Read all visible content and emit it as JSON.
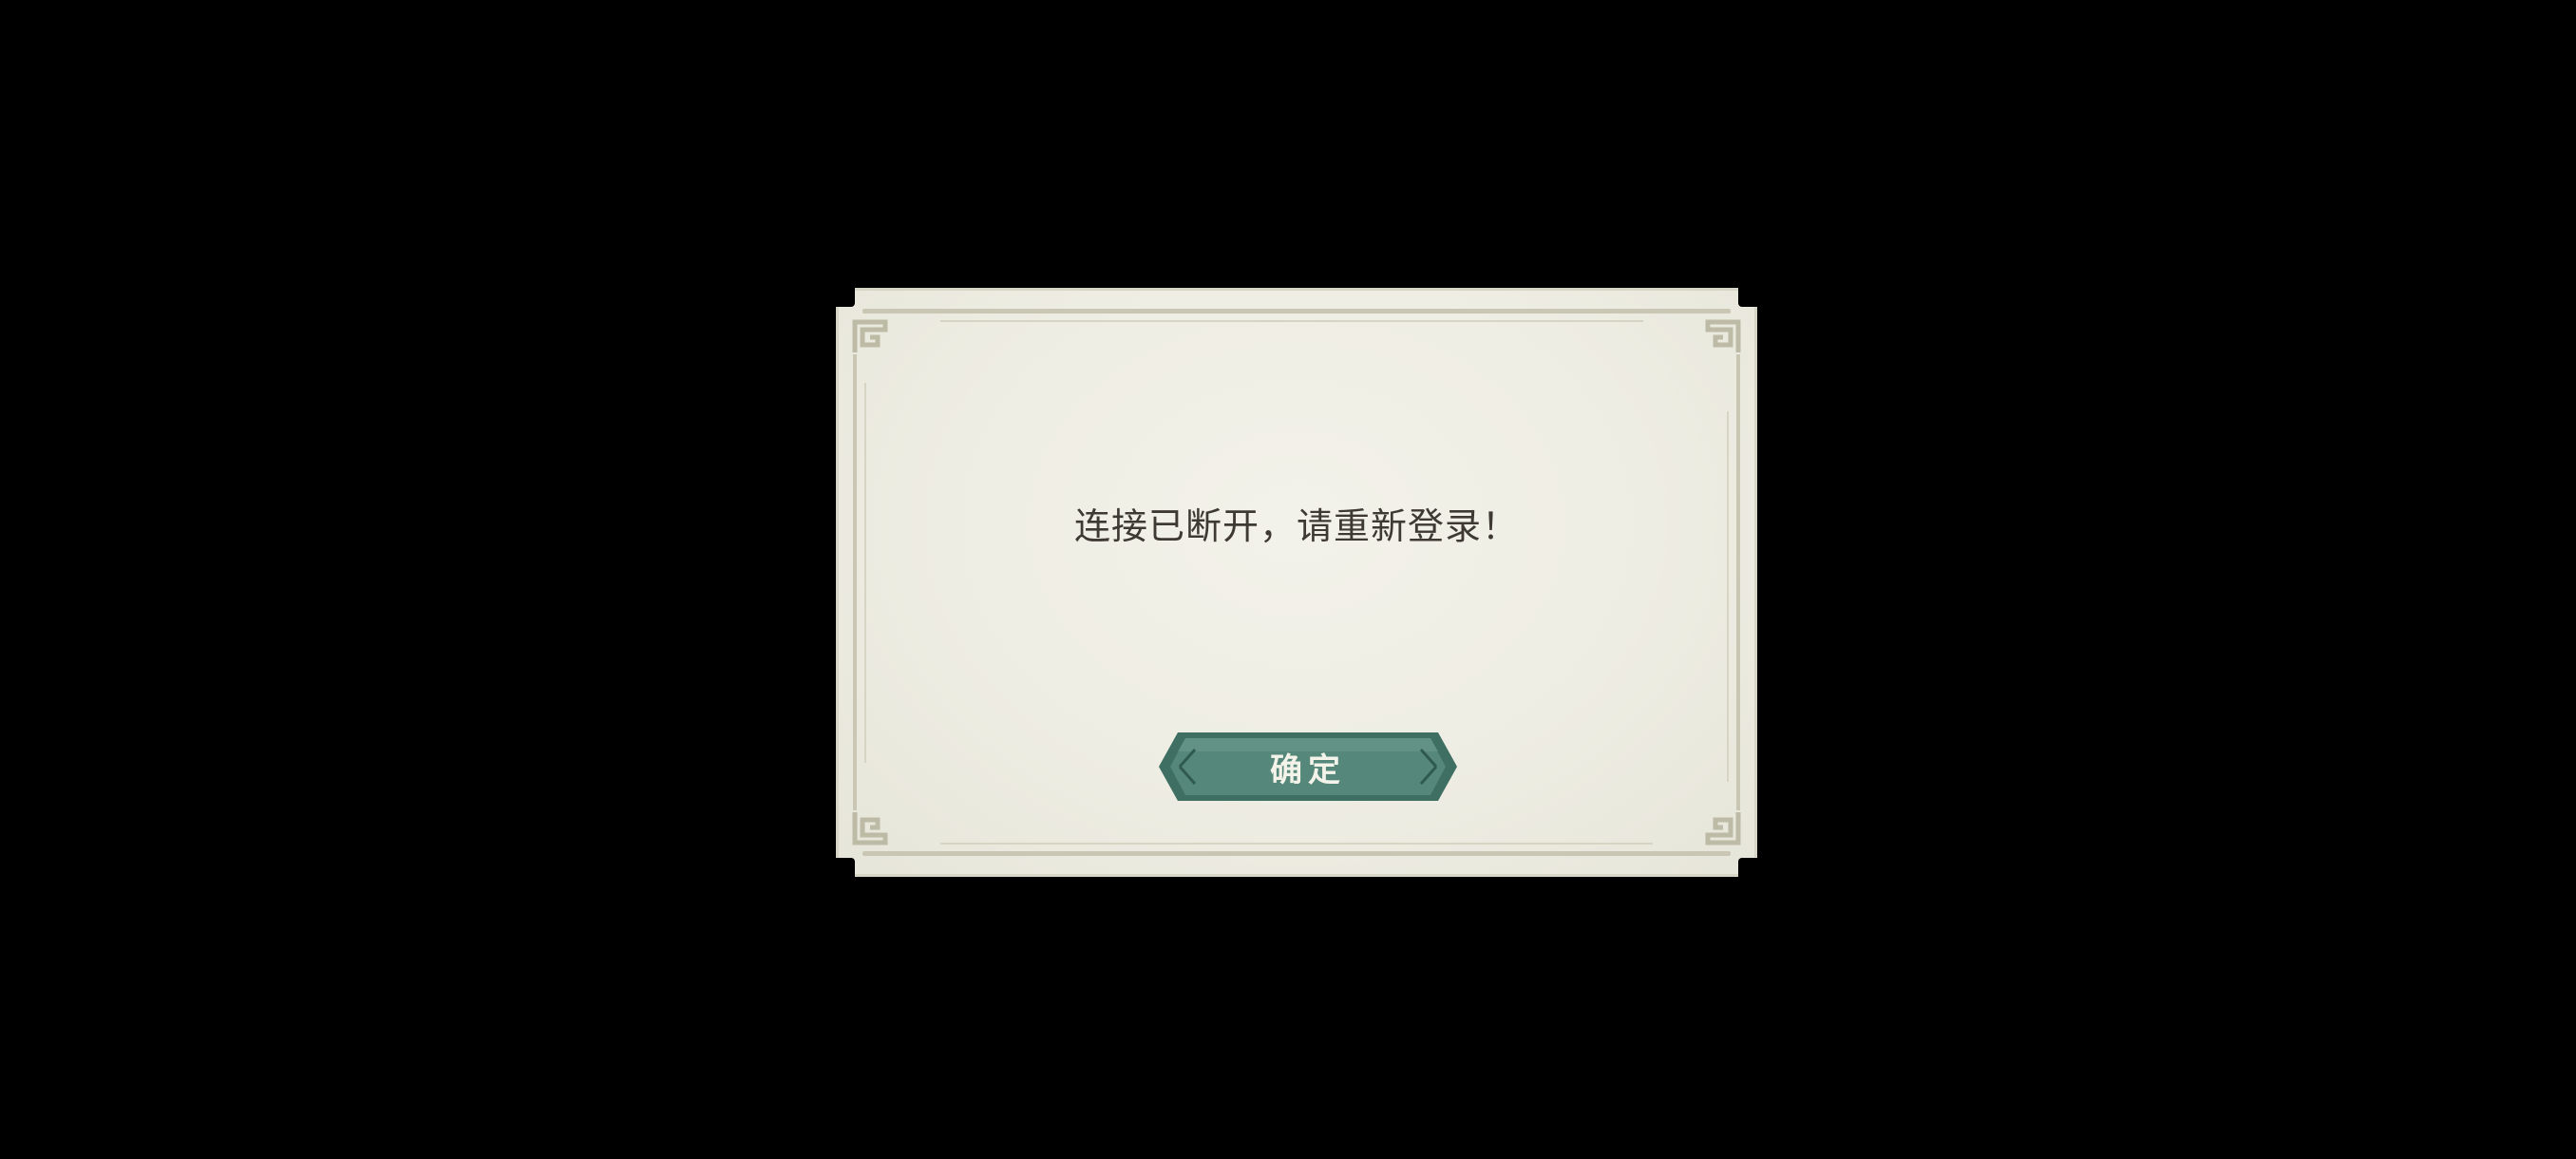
{
  "dialog": {
    "message": "连接已断开，请重新登录！",
    "confirm_label": "确定"
  },
  "colors": {
    "background": "#000000",
    "paper": "#efeee4",
    "frame": "#c9c7b4",
    "button": "#4e8173",
    "button_text": "#f4f3ea",
    "message_text": "#3e3a33"
  },
  "icons": {
    "corner": "fret-corner-ornament-icon"
  }
}
